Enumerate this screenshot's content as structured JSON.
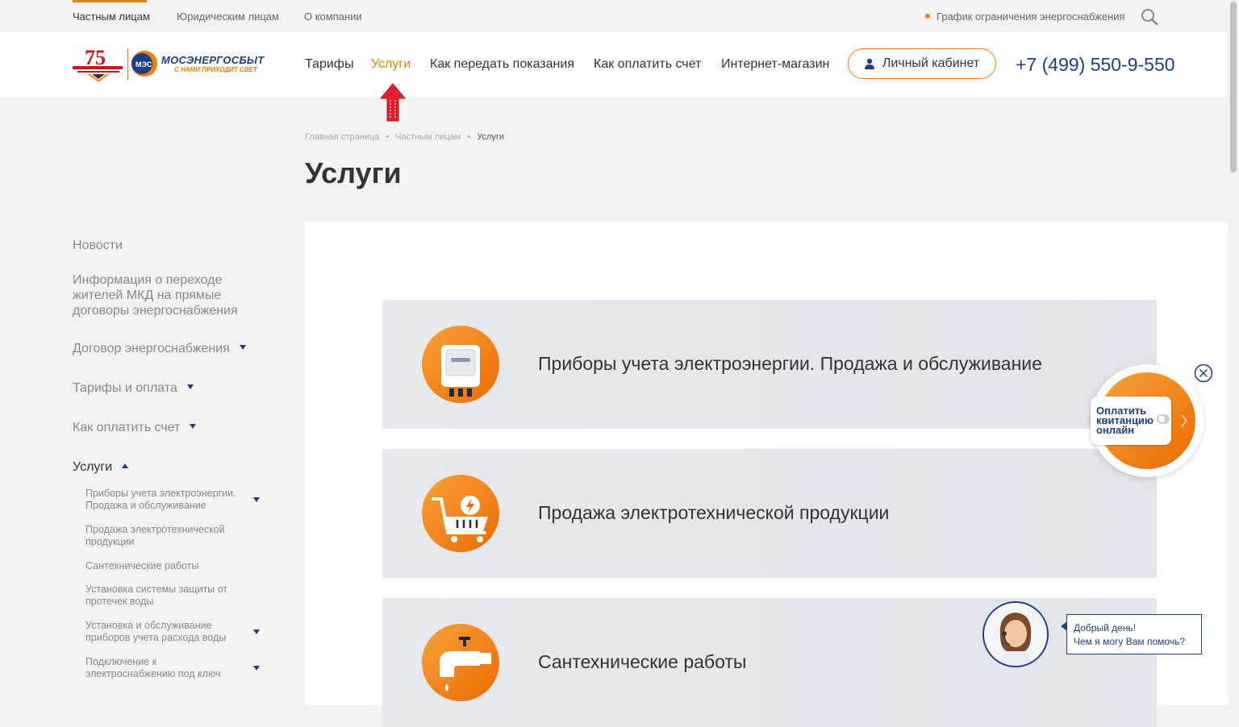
{
  "topbar": {
    "segments": [
      "Частным лицам",
      "Юридическим лицам",
      "О компании"
    ],
    "outage_link": "График ограничения энергоснабжения",
    "search_icon": "search-icon"
  },
  "header": {
    "logo_anniversary": "75",
    "brand_name": "МОСЭНЕРГОСБЫТ",
    "brand_slogan": "С НАМИ ПРИХОДИТ СВЕТ",
    "logo_badge": "МЭС",
    "nav": [
      "Тарифы",
      "Услуги",
      "Как передать показания",
      "Как оплатить счет",
      "Интернет-магазин"
    ],
    "active_nav": "Услуги",
    "cabinet_label": "Личный кабинет",
    "phone": "+7 (499) 550-9-550",
    "accent_color": "#f07d00",
    "brand_color": "#1d3d84"
  },
  "breadcrumb": [
    "Главная страница",
    "Частным лицам",
    "Услуги"
  ],
  "page_title": "Услуги",
  "sidebar": {
    "items": [
      {
        "label": "Новости"
      },
      {
        "label": "Информация о переходе жителей МКД на прямые договоры энергоснабжения"
      },
      {
        "label": "Договор энергоснабжения"
      },
      {
        "label": "Тарифы и оплата"
      },
      {
        "label": "Как оплатить счет"
      },
      {
        "label": "Услуги"
      }
    ],
    "subitems": [
      {
        "label": "Приборы учета электроэнергии. Продажа и обслуживание"
      },
      {
        "label": "Продажа электротехнической продукции"
      },
      {
        "label": "Сантехнические работы"
      },
      {
        "label": "Установка системы защиты от протечек воды"
      },
      {
        "label": "Установка и обслуживание приборов учета расхода воды"
      },
      {
        "label": "Подключение к электроснабжению под ключ"
      }
    ]
  },
  "services": [
    {
      "title": "Приборы учета электроэнергии. Продажа и обслуживание",
      "icon": "meter-icon"
    },
    {
      "title": "Продажа электротехнической продукции",
      "icon": "shopping-cart-icon"
    },
    {
      "title": "Сантехнические работы",
      "icon": "faucet-icon"
    }
  ],
  "pay_widget": {
    "label_line1": "Оплатить",
    "label_line2": "квитанцию",
    "label_line3": "онлайн"
  },
  "chat": {
    "line1": "Добрый день!",
    "line2": "Чем я могу Вам помочь?"
  }
}
